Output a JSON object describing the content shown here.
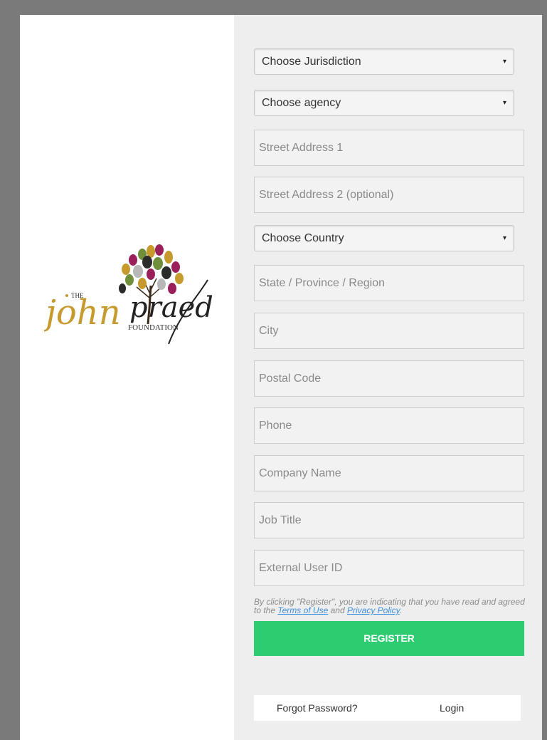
{
  "logo": {
    "the": "THE",
    "script": "john",
    "surname": "praed",
    "foundation": "FOUNDATION"
  },
  "form": {
    "jurisdiction": "Choose Jurisdiction",
    "agency": "Choose agency",
    "street1_placeholder": "Street Address 1",
    "street2_placeholder": "Street Address 2 (optional)",
    "country": "Choose Country",
    "state_placeholder": "State / Province / Region",
    "city_placeholder": "City",
    "postal_placeholder": "Postal Code",
    "phone_placeholder": "Phone",
    "company_placeholder": "Company Name",
    "jobtitle_placeholder": "Job Title",
    "external_id_placeholder": "External User ID",
    "caret": "▾"
  },
  "legal": {
    "prefix": "By clicking \"Register\", you are indicating that you have read and agreed to the ",
    "terms": "Terms of Use",
    "and": " and ",
    "privacy": "Privacy Policy",
    "suffix": "."
  },
  "register_label": "REGISTER",
  "footer": {
    "forgot": "Forgot Password?",
    "login": "Login"
  },
  "colors": {
    "register": "#2ecc71",
    "link": "#3d8fe0",
    "panel": "#eeeeee"
  }
}
